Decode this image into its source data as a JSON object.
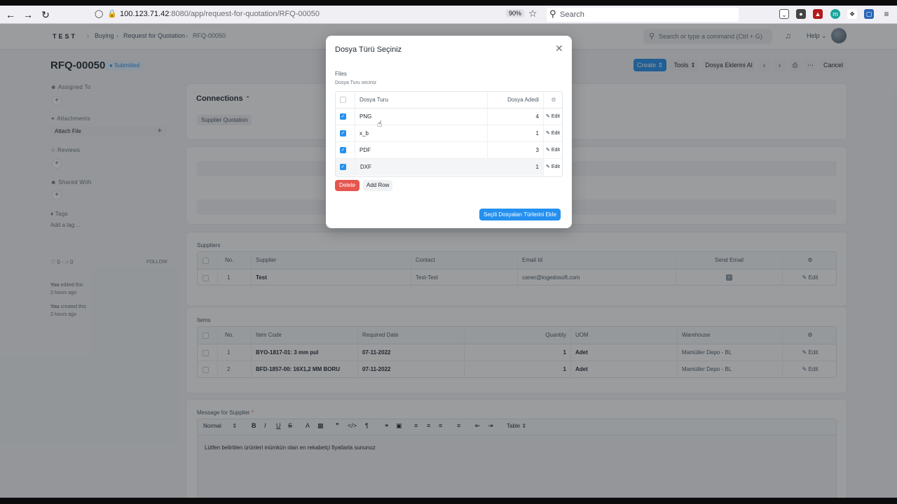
{
  "browser": {
    "url_main": "100.123.71.42",
    "url_rest": ":8080/app/request-for-quotation/RFQ-00050",
    "zoom": "90%",
    "search_placeholder": "Search"
  },
  "navbar": {
    "logo": "TEST",
    "breadcrumbs": [
      "Buying",
      "Request for Quotation",
      "RFQ-00050"
    ],
    "command_placeholder": "Search or type a command (Ctrl + G)",
    "help": "Help"
  },
  "page": {
    "title": "RFQ-00050",
    "status": "Submitted",
    "buttons": {
      "create": "Create",
      "tools": "Tools",
      "attach_all": "Dosya Eklerini Al",
      "cancel": "Cancel"
    }
  },
  "sidebar": {
    "assigned_to": "Assigned To",
    "attachments": "Attachments",
    "attach_file": "Attach File",
    "reviews": "Reviews",
    "shared_with": "Shared With",
    "tags": "Tags",
    "add_tag": "Add a tag ...",
    "likes": "0",
    "comments": "0",
    "follow": "FOLLOW",
    "activity": [
      {
        "who": "You",
        "what": "edited this",
        "when": "2 hours ago"
      },
      {
        "who": "You",
        "what": "created this",
        "when": "2 hours ago"
      }
    ]
  },
  "connections": {
    "title": "Connections",
    "link": "Supplier Quotation"
  },
  "suppliers": {
    "label": "Suppliers",
    "headers": [
      "No.",
      "Supplier",
      "Contact",
      "Email Id",
      "Send Email"
    ],
    "rows": [
      {
        "no": "1",
        "supplier": "Test",
        "contact": "Test-Test",
        "email": "caner@logedosoft.com"
      }
    ],
    "edit": "Edit"
  },
  "items": {
    "label": "Items",
    "headers": [
      "No.",
      "Item Code",
      "Required Date",
      "Quantity",
      "UOM",
      "Warehouse"
    ],
    "rows": [
      {
        "no": "1",
        "code": "BYO-1817-01: 3 mm pul",
        "date": "07-11-2022",
        "qty": "1",
        "uom": "Adet",
        "wh": "Mamüller Depo - BL"
      },
      {
        "no": "2",
        "code": "BFD-1857-00: 16X1,2 MM BORU",
        "date": "07-11-2022",
        "qty": "1",
        "uom": "Adet",
        "wh": "Mamüller Depo - BL"
      }
    ],
    "edit": "Edit"
  },
  "message": {
    "label": "Message for Supplier",
    "required_mark": "*",
    "format": "Normal",
    "table": "Table",
    "text": "Lütfen belirtilen ürünleri mümkün olan en rekabetçi fiyatlarla sununuz"
  },
  "modal": {
    "title": "Dosya Türü Seçiniz",
    "field_label": "Files",
    "field_desc": "Dosya Turu seciniz",
    "headers": [
      "Dosya Turu",
      "Dosya Adedi"
    ],
    "rows": [
      {
        "type": "PNG",
        "count": "4",
        "checked": true
      },
      {
        "type": "x_b",
        "count": "1",
        "checked": true
      },
      {
        "type": "PDF",
        "count": "3",
        "checked": true
      },
      {
        "type": "DXF",
        "count": "1",
        "checked": true
      }
    ],
    "edit": "Edit",
    "delete": "Delete",
    "add_row": "Add Row",
    "primary": "Seçili Dosyaları Türlerini Ekle"
  },
  "colors": {
    "primary": "#2490ef",
    "danger": "#e5564f"
  }
}
